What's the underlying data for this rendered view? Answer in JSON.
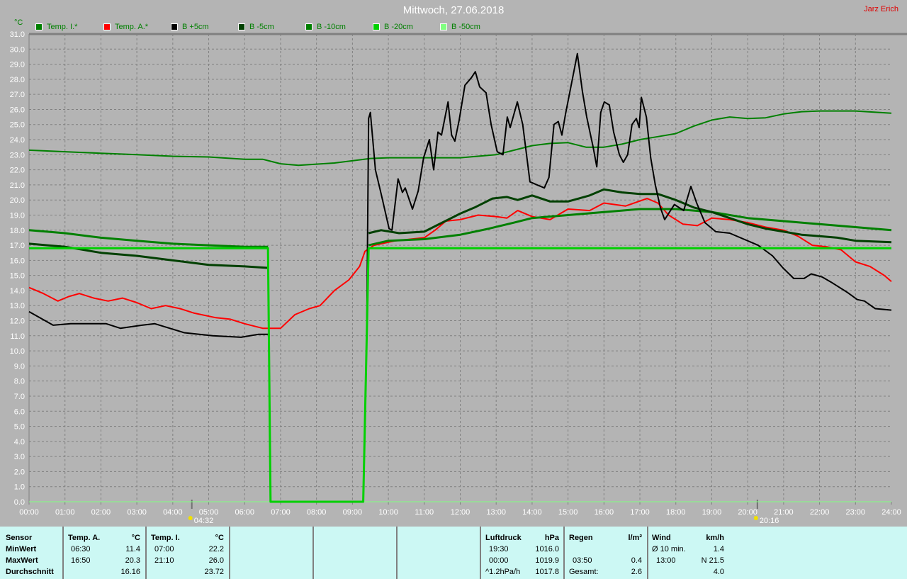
{
  "header": {
    "title": "Mittwoch, 27.06.2018",
    "author": "Jarz Erich",
    "unit": "°C"
  },
  "chart_data": {
    "type": "line",
    "title": "Mittwoch, 27.06.2018",
    "xlabel": "",
    "ylabel": "°C",
    "xlim": [
      0,
      24
    ],
    "ylim": [
      0,
      31
    ],
    "grid": true,
    "legend_placement": "top",
    "x_ticks": [
      "00:00",
      "01:00",
      "02:00",
      "03:00",
      "04:00",
      "05:00",
      "06:00",
      "07:00",
      "08:00",
      "09:00",
      "10:00",
      "11:00",
      "12:00",
      "13:00",
      "14:00",
      "15:00",
      "16:00",
      "17:00",
      "18:00",
      "19:00",
      "20:00",
      "21:00",
      "22:00",
      "23:00",
      "24:00"
    ],
    "y_ticks": [
      "0.0",
      "1.0",
      "2.0",
      "3.0",
      "4.0",
      "5.0",
      "6.0",
      "7.0",
      "8.0",
      "9.0",
      "10.0",
      "11.0",
      "12.0",
      "13.0",
      "14.0",
      "15.0",
      "16.0",
      "17.0",
      "18.0",
      "19.0",
      "20.0",
      "21.0",
      "22.0",
      "23.0",
      "24.0",
      "25.0",
      "26.0",
      "27.0",
      "28.0",
      "29.0",
      "30.0",
      "31.0"
    ],
    "markers": [
      {
        "label": "04:32",
        "x": 4.53,
        "icon": "sunrise-icon"
      },
      {
        "label": "20:16",
        "x": 20.27,
        "icon": "sunset-icon"
      }
    ],
    "series": [
      {
        "name": "Temp. I.*",
        "color": "#008000",
        "width": 2,
        "points": [
          [
            0,
            23.3
          ],
          [
            1,
            23.2
          ],
          [
            2,
            23.1
          ],
          [
            3,
            23.0
          ],
          [
            4,
            22.9
          ],
          [
            5,
            22.85
          ],
          [
            6,
            22.7
          ],
          [
            6.5,
            22.7
          ],
          [
            7,
            22.4
          ],
          [
            7.5,
            22.3
          ],
          [
            8.5,
            22.45
          ],
          [
            9.5,
            22.75
          ],
          [
            10,
            22.8
          ],
          [
            11,
            22.8
          ],
          [
            12,
            22.8
          ],
          [
            13,
            23.0
          ],
          [
            13.5,
            23.3
          ],
          [
            14,
            23.6
          ],
          [
            14.5,
            23.75
          ],
          [
            15,
            23.8
          ],
          [
            15.5,
            23.5
          ],
          [
            16,
            23.5
          ],
          [
            16.5,
            23.7
          ],
          [
            17,
            24.0
          ],
          [
            17.5,
            24.2
          ],
          [
            18,
            24.4
          ],
          [
            18.5,
            24.9
          ],
          [
            19,
            25.3
          ],
          [
            19.5,
            25.5
          ],
          [
            20,
            25.4
          ],
          [
            20.5,
            25.45
          ],
          [
            21,
            25.7
          ],
          [
            21.5,
            25.85
          ],
          [
            22,
            25.9
          ],
          [
            23,
            25.9
          ],
          [
            24,
            25.75
          ]
        ]
      },
      {
        "name": "Temp. A.*",
        "color": "#ff0000",
        "width": 2,
        "points": [
          [
            0,
            14.2
          ],
          [
            0.4,
            13.8
          ],
          [
            0.8,
            13.3
          ],
          [
            1.1,
            13.6
          ],
          [
            1.4,
            13.8
          ],
          [
            1.8,
            13.5
          ],
          [
            2.2,
            13.3
          ],
          [
            2.6,
            13.5
          ],
          [
            3.0,
            13.2
          ],
          [
            3.4,
            12.8
          ],
          [
            3.8,
            13.0
          ],
          [
            4.2,
            12.8
          ],
          [
            4.6,
            12.5
          ],
          [
            5.2,
            12.2
          ],
          [
            5.6,
            12.1
          ],
          [
            6.0,
            11.8
          ],
          [
            6.5,
            11.5
          ],
          [
            7.0,
            11.5
          ],
          [
            7.4,
            12.4
          ],
          [
            7.8,
            12.8
          ],
          [
            8.1,
            13.0
          ],
          [
            8.5,
            14.0
          ],
          [
            8.9,
            14.7
          ],
          [
            9.2,
            15.6
          ],
          [
            9.35,
            16.6
          ],
          [
            9.6,
            17.0
          ],
          [
            10.2,
            17.3
          ],
          [
            11,
            17.5
          ],
          [
            11.3,
            18.0
          ],
          [
            11.6,
            18.6
          ],
          [
            12.0,
            18.7
          ],
          [
            12.5,
            19.0
          ],
          [
            13,
            18.9
          ],
          [
            13.3,
            18.8
          ],
          [
            13.6,
            19.3
          ],
          [
            14.0,
            18.9
          ],
          [
            14.5,
            18.7
          ],
          [
            15.0,
            19.4
          ],
          [
            15.6,
            19.3
          ],
          [
            16.0,
            19.8
          ],
          [
            16.6,
            19.6
          ],
          [
            17.2,
            20.1
          ],
          [
            17.5,
            19.8
          ],
          [
            17.8,
            19.0
          ],
          [
            18.2,
            18.4
          ],
          [
            18.6,
            18.3
          ],
          [
            19.0,
            18.8
          ],
          [
            19.5,
            18.7
          ],
          [
            20.0,
            18.5
          ],
          [
            20.5,
            18.2
          ],
          [
            21.0,
            18.0
          ],
          [
            21.4,
            17.6
          ],
          [
            21.8,
            17.0
          ],
          [
            22.2,
            16.9
          ],
          [
            22.6,
            16.7
          ],
          [
            23.0,
            15.9
          ],
          [
            23.4,
            15.6
          ],
          [
            23.8,
            15.0
          ],
          [
            24,
            14.6
          ]
        ]
      },
      {
        "name": "B +5cm",
        "color": "#000000",
        "width": 2,
        "points": [
          [
            0,
            12.6
          ],
          [
            0.67,
            11.7
          ],
          [
            1.16,
            11.8
          ],
          [
            2.15,
            11.8
          ],
          [
            2.54,
            11.5
          ],
          [
            3.14,
            11.7
          ],
          [
            3.5,
            11.8
          ],
          [
            4.32,
            11.2
          ],
          [
            5.11,
            11.0
          ],
          [
            5.9,
            10.9
          ],
          [
            6.39,
            11.1
          ],
          [
            6.65,
            11.1
          ],
          [
            6.67,
            null
          ],
          [
            9.39,
            null
          ],
          [
            9.4,
            12.0
          ],
          [
            9.45,
            25.4
          ],
          [
            9.5,
            25.8
          ],
          [
            9.64,
            22.0
          ],
          [
            9.8,
            20.4
          ],
          [
            10.02,
            18.1
          ],
          [
            10.1,
            18.0
          ],
          [
            10.27,
            21.4
          ],
          [
            10.39,
            20.5
          ],
          [
            10.47,
            20.8
          ],
          [
            10.67,
            19.4
          ],
          [
            10.83,
            20.6
          ],
          [
            10.98,
            22.8
          ],
          [
            11.14,
            24.0
          ],
          [
            11.26,
            22.0
          ],
          [
            11.38,
            24.5
          ],
          [
            11.48,
            24.3
          ],
          [
            11.66,
            26.5
          ],
          [
            11.76,
            24.3
          ],
          [
            11.85,
            23.9
          ],
          [
            11.97,
            25.3
          ],
          [
            12.13,
            27.6
          ],
          [
            12.31,
            28.1
          ],
          [
            12.42,
            28.5
          ],
          [
            12.54,
            27.5
          ],
          [
            12.72,
            27.1
          ],
          [
            12.86,
            25.0
          ],
          [
            13.03,
            23.2
          ],
          [
            13.19,
            23.0
          ],
          [
            13.31,
            25.5
          ],
          [
            13.39,
            24.8
          ],
          [
            13.59,
            26.5
          ],
          [
            13.74,
            25.0
          ],
          [
            13.94,
            21.2
          ],
          [
            14.14,
            21.0
          ],
          [
            14.34,
            20.8
          ],
          [
            14.47,
            21.5
          ],
          [
            14.61,
            25.0
          ],
          [
            14.73,
            25.2
          ],
          [
            14.83,
            24.3
          ],
          [
            14.93,
            25.7
          ],
          [
            15.12,
            28.0
          ],
          [
            15.26,
            29.7
          ],
          [
            15.4,
            27.2
          ],
          [
            15.52,
            25.5
          ],
          [
            15.7,
            23.5
          ],
          [
            15.8,
            22.2
          ],
          [
            15.91,
            25.8
          ],
          [
            16.01,
            26.5
          ],
          [
            16.15,
            26.3
          ],
          [
            16.27,
            24.5
          ],
          [
            16.43,
            23.0
          ],
          [
            16.54,
            22.5
          ],
          [
            16.66,
            23.0
          ],
          [
            16.78,
            25.0
          ],
          [
            16.9,
            25.4
          ],
          [
            16.98,
            24.8
          ],
          [
            17.04,
            26.8
          ],
          [
            17.18,
            25.5
          ],
          [
            17.3,
            22.8
          ],
          [
            17.43,
            21.0
          ],
          [
            17.57,
            19.5
          ],
          [
            17.69,
            18.7
          ],
          [
            17.96,
            19.7
          ],
          [
            18.22,
            19.3
          ],
          [
            18.42,
            20.9
          ],
          [
            18.58,
            19.8
          ],
          [
            18.81,
            18.5
          ],
          [
            19.11,
            17.9
          ],
          [
            19.5,
            17.8
          ],
          [
            20.29,
            17.0
          ],
          [
            20.69,
            16.3
          ],
          [
            20.98,
            15.5
          ],
          [
            21.28,
            14.8
          ],
          [
            21.57,
            14.8
          ],
          [
            21.77,
            15.1
          ],
          [
            22.07,
            14.9
          ],
          [
            22.36,
            14.5
          ],
          [
            22.76,
            13.9
          ],
          [
            23.05,
            13.4
          ],
          [
            23.25,
            13.3
          ],
          [
            23.55,
            12.8
          ],
          [
            24,
            12.7
          ]
        ]
      },
      {
        "name": "B -5cm",
        "color": "#004000",
        "width": 3,
        "points": [
          [
            0,
            17.1
          ],
          [
            1,
            16.9
          ],
          [
            2,
            16.5
          ],
          [
            3,
            16.3
          ],
          [
            4,
            16.0
          ],
          [
            5,
            15.7
          ],
          [
            6,
            15.6
          ],
          [
            6.65,
            15.5
          ],
          [
            6.67,
            null
          ],
          [
            9.44,
            null
          ],
          [
            9.45,
            17.8
          ],
          [
            9.8,
            18.0
          ],
          [
            10.3,
            17.8
          ],
          [
            11,
            17.9
          ],
          [
            11.5,
            18.5
          ],
          [
            12,
            19.1
          ],
          [
            12.4,
            19.5
          ],
          [
            12.9,
            20.1
          ],
          [
            13.3,
            20.2
          ],
          [
            13.6,
            20.0
          ],
          [
            14,
            20.3
          ],
          [
            14.5,
            19.9
          ],
          [
            15,
            19.9
          ],
          [
            15.6,
            20.3
          ],
          [
            16,
            20.7
          ],
          [
            16.5,
            20.5
          ],
          [
            17,
            20.4
          ],
          [
            17.5,
            20.4
          ],
          [
            18,
            20.0
          ],
          [
            18.5,
            19.5
          ],
          [
            19,
            19.2
          ],
          [
            19.5,
            18.8
          ],
          [
            20,
            18.4
          ],
          [
            20.5,
            18.1
          ],
          [
            21,
            17.9
          ],
          [
            21.5,
            17.7
          ],
          [
            22,
            17.6
          ],
          [
            22.5,
            17.5
          ],
          [
            23,
            17.3
          ],
          [
            24,
            17.2
          ]
        ]
      },
      {
        "name": "B -10cm",
        "color": "#008000",
        "width": 3,
        "points": [
          [
            0,
            18.0
          ],
          [
            1,
            17.8
          ],
          [
            2,
            17.5
          ],
          [
            3,
            17.3
          ],
          [
            4,
            17.1
          ],
          [
            5,
            17.0
          ],
          [
            6,
            16.9
          ],
          [
            6.65,
            16.9
          ],
          [
            6.67,
            null
          ],
          [
            9.44,
            null
          ],
          [
            9.45,
            17.0
          ],
          [
            10,
            17.3
          ],
          [
            11,
            17.4
          ],
          [
            12,
            17.7
          ],
          [
            12.8,
            18.1
          ],
          [
            13.5,
            18.5
          ],
          [
            14,
            18.8
          ],
          [
            15,
            19.0
          ],
          [
            16,
            19.2
          ],
          [
            17,
            19.4
          ],
          [
            18,
            19.4
          ],
          [
            19,
            19.2
          ],
          [
            20,
            18.8
          ],
          [
            21,
            18.6
          ],
          [
            22,
            18.4
          ],
          [
            23,
            18.2
          ],
          [
            24,
            18.0
          ]
        ]
      },
      {
        "name": "B -20cm",
        "color": "#00d000",
        "width": 3,
        "points": [
          [
            0,
            16.8
          ],
          [
            6.65,
            16.8
          ],
          [
            6.72,
            0
          ],
          [
            9.3,
            0
          ],
          [
            9.45,
            16.8
          ],
          [
            24,
            16.8
          ]
        ]
      },
      {
        "name": "B -50cm",
        "color": "#80ff80",
        "width": 1,
        "points": [
          [
            0,
            0
          ],
          [
            24,
            0
          ]
        ]
      }
    ]
  },
  "summary": {
    "sensor_header": {
      "label": "Sensor",
      "min": "MinWert",
      "max": "MaxWert",
      "avg": "Durchschnitt"
    },
    "temp_a": {
      "title": "Temp. A.",
      "unit": "°C",
      "min_time": "06:30",
      "min": "11.4",
      "max_time": "16:50",
      "max": "20.3",
      "avg": "16.16"
    },
    "temp_i": {
      "title": "Temp. I.",
      "unit": "°C",
      "min_time": "07:00",
      "min": "22.2",
      "max_time": "21:10",
      "max": "26.0",
      "avg": "23.72"
    },
    "pressure": {
      "title": "Luftdruck",
      "unit": "hPa",
      "min_time": "19:30",
      "min": "1016.0",
      "max_time": "00:00",
      "max": "1019.9",
      "trend": "^1.2hPa/h",
      "current": "1017.8"
    },
    "rain": {
      "title": "Regen",
      "unit": "l/m²",
      "max_time": "03:50",
      "max": "0.4",
      "total_label": "Gesamt:",
      "total": "2.6"
    },
    "wind": {
      "title": "Wind",
      "unit": "km/h",
      "avg_label": "Ø 10 min.",
      "avg": "1.4",
      "max_time": "13:00",
      "max": "N 21.5",
      "value3": "4.0"
    }
  }
}
